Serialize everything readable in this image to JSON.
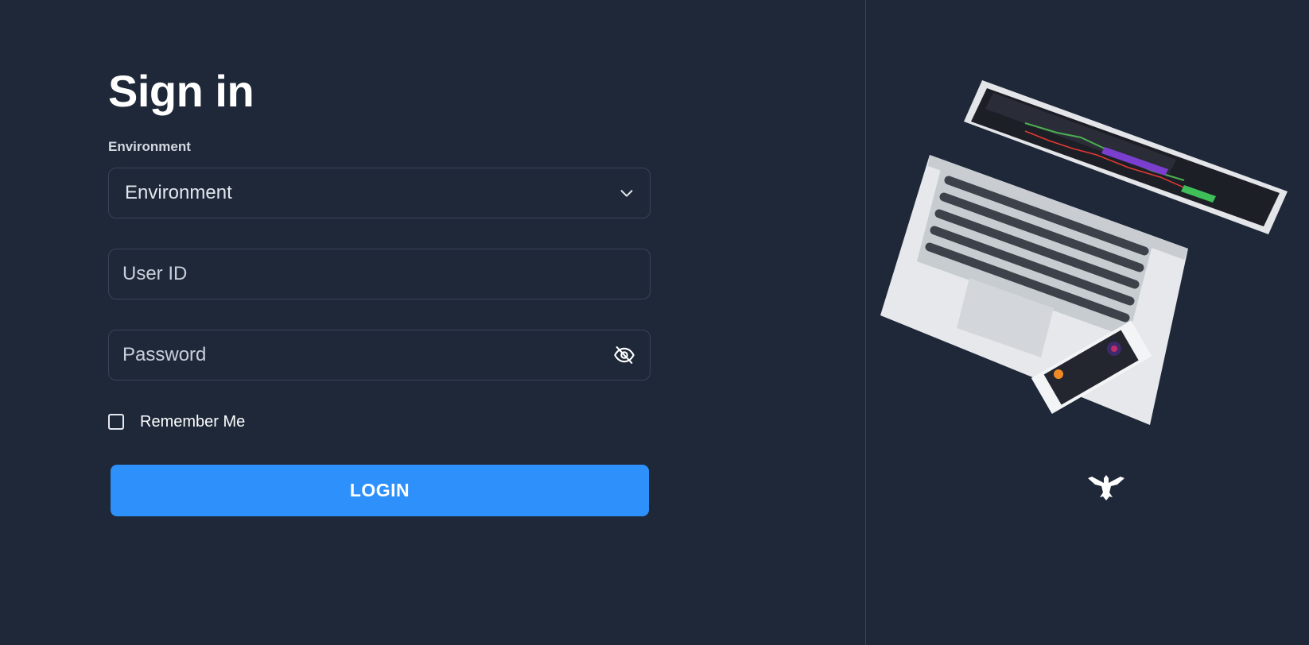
{
  "login_form": {
    "title": "Sign in",
    "environment_label": "Environment",
    "environment_select_value": "Environment",
    "user_id_placeholder": "User ID",
    "password_placeholder": "Password",
    "remember_me_label": "Remember Me",
    "login_button_label": "LOGIN"
  },
  "icons": {
    "environment_dropdown": "chevron-down-icon",
    "password_toggle": "eye-off-icon",
    "brand": "eagle-logo-icon"
  },
  "colors": {
    "background": "#1e2839",
    "field_border": "#3a4458",
    "primary_button": "#2e90fa",
    "text": "#ffffff"
  }
}
